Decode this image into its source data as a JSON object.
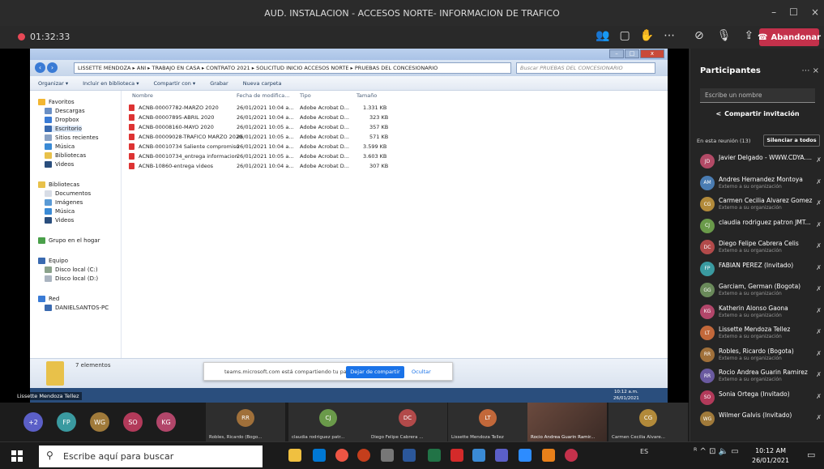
{
  "window": {
    "title": "AUD. INSTALACION - ACCESOS NORTE- INFORMACION DE TRAFICO",
    "min": "–",
    "max": "☐",
    "close": "×"
  },
  "toolbar": {
    "timer": "01:32:33",
    "leave_label": "Abandonar"
  },
  "explorer": {
    "breadcrumb": "LISSETTE MENDOZA ▸ ANI ▸ TRABAJO EN CASA ▸ CONTRATO 2021 ▸ SOLICITUD INICIO ACCESOS NORTE ▸ PRUEBAS DEL CONCESIONARIO",
    "search_placeholder": "Buscar PRUEBAS DEL CONCESIONARIO",
    "commands": [
      "Organizar ▾",
      "Incluir en biblioteca ▾",
      "Compartir con ▾",
      "Grabar",
      "Nueva carpeta"
    ],
    "nav": [
      "Favoritos",
      "Descargas",
      "Dropbox",
      "Escritorio",
      "Sitios recientes",
      "Música",
      "Bibliotecas",
      "Videos",
      "Bibliotecas",
      "Documentos",
      "Imágenes",
      "Música",
      "Videos",
      "Grupo en el hogar",
      "Equipo",
      "Disco local (C:)",
      "Disco local (D:)",
      "Red",
      "DANIELSANTOS-PC"
    ],
    "columns": [
      "Nombre",
      "Fecha de modifica...",
      "Tipo",
      "Tamaño"
    ],
    "files": [
      {
        "name": "ACNB-00007782-MARZO 2020",
        "date": "26/01/2021 10:04 a...",
        "type": "Adobe Acrobat D...",
        "size": "1.331 KB"
      },
      {
        "name": "ACNB-00007895-ABRIL 2020",
        "date": "26/01/2021 10:04 a...",
        "type": "Adobe Acrobat D...",
        "size": "323 KB"
      },
      {
        "name": "ACNB-00008160-MAYO 2020",
        "date": "26/01/2021 10:05 a...",
        "type": "Adobe Acrobat D...",
        "size": "357 KB"
      },
      {
        "name": "ACNB-00009028-TRAFICO MARZO 2020",
        "date": "26/01/2021 10:05 a...",
        "type": "Adobe Acrobat D...",
        "size": "571 KB"
      },
      {
        "name": "ACNB-00010734 Saliente compromiso",
        "date": "26/01/2021 10:04 a...",
        "type": "Adobe Acrobat D...",
        "size": "3.599 KB"
      },
      {
        "name": "ACNB-00010734_entrega informacion",
        "date": "26/01/2021 10:05 a...",
        "type": "Adobe Acrobat D...",
        "size": "3.603 KB"
      },
      {
        "name": "ACNB-10860-entrega videos",
        "date": "26/01/2021 10:04 a...",
        "type": "Adobe Acrobat D...",
        "size": "307 KB"
      }
    ],
    "status": "7 elementos",
    "inner_clock": "10:12 a.m.",
    "inner_date": "26/01/2021"
  },
  "share_bar": {
    "text": "teams.microsoft.com está compartiendo tu pantalla.",
    "stop": "Dejar de compartir",
    "hide": "Ocultar"
  },
  "presenter": "Lissette Mendoza Tellez",
  "roster": {
    "title": "Participantes",
    "search_placeholder": "Escribe un nombre",
    "invite": "Compartir invitación",
    "in_meeting": "En esta reunión (13)",
    "mute_all": "Silenciar a todos",
    "people": [
      {
        "initials": "JD",
        "name": "Javier Delgado - WWW.CDYA....",
        "sub": "",
        "color": "#b24a66"
      },
      {
        "initials": "AM",
        "name": "Andres Hernandez Montoya",
        "sub": "Externo a su organización",
        "color": "#4a7cb2"
      },
      {
        "initials": "CG",
        "name": "Carmen Cecilia Alvarez Gomez",
        "sub": "Externo a su organización",
        "color": "#b28a3a"
      },
      {
        "initials": "CJ",
        "name": "claudia rodriguez patron JMT...",
        "sub": "",
        "color": "#6a9a4a"
      },
      {
        "initials": "DC",
        "name": "Diego Felipe Cabrera Celis",
        "sub": "Externo a su organización",
        "color": "#b24a4a"
      },
      {
        "initials": "FP",
        "name": "FABIAN PEREZ (Invitado)",
        "sub": "",
        "color": "#3a9aa0"
      },
      {
        "initials": "GG",
        "name": "Garciam, German (Bogota)",
        "sub": "Externo a su organización",
        "color": "#6a8a5a"
      },
      {
        "initials": "KG",
        "name": "Katherin Alonso Gaona",
        "sub": "Externo a su organización",
        "color": "#b2466a"
      },
      {
        "initials": "LT",
        "name": "Lissette Mendoza Tellez",
        "sub": "Externo a su organización",
        "color": "#c2683a"
      },
      {
        "initials": "RR",
        "name": "Robles, Ricardo (Bogota)",
        "sub": "Externo a su organización",
        "color": "#a0703a"
      },
      {
        "initials": "RR",
        "name": "Rocio Andrea Guarin Ramirez",
        "sub": "Externo a su organización",
        "color": "#6a5aa0"
      },
      {
        "initials": "SO",
        "name": "Sonia Ortega (Invitado)",
        "sub": "",
        "color": "#b23a5a"
      },
      {
        "initials": "WG",
        "name": "Wilmer Galvis (Invitado)",
        "sub": "",
        "color": "#a07a3a"
      }
    ]
  },
  "gallery": {
    "avatars": [
      {
        "initials": "+2",
        "color": "#5b5fc7"
      },
      {
        "initials": "FP",
        "color": "#3a9aa0"
      },
      {
        "initials": "WG",
        "color": "#a07a3a"
      },
      {
        "initials": "SO",
        "color": "#b23a5a"
      },
      {
        "initials": "KG",
        "color": "#b2466a"
      }
    ],
    "tiles": [
      {
        "initials": "RR",
        "name": "Robles, Ricardo (Bogo...",
        "color": "#a0703a"
      },
      {
        "initials": "CJ",
        "name": "claudia rodriguez patr...",
        "color": "#6a9a4a"
      },
      {
        "initials": "DC",
        "name": "Diego Felipe Cabrera ...",
        "color": "#b24a4a"
      },
      {
        "initials": "LT",
        "name": "Lissette Mendoza Tellez",
        "color": "#c2683a"
      },
      {
        "initials": "CG",
        "name": "Carmen Cecilia Alvare...",
        "color": "#b28a3a"
      }
    ],
    "video_name": "Rocio Andrea Guarin Ramir..."
  },
  "taskbar": {
    "search_placeholder": "Escribe aquí para buscar",
    "lang": "ES",
    "time": "10:12 AM",
    "date": "26/01/2021"
  }
}
